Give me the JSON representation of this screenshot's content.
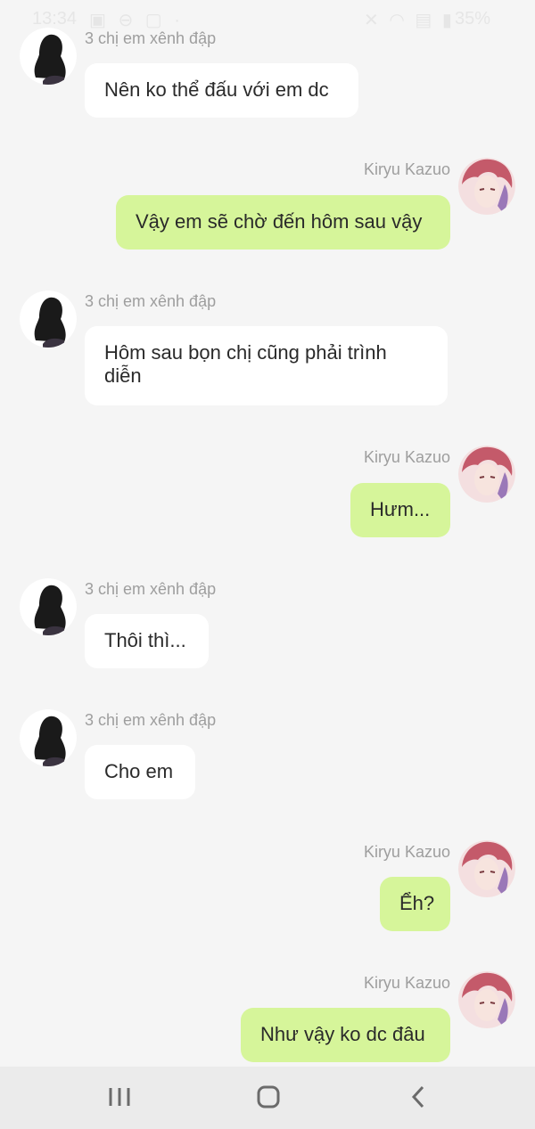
{
  "status": {
    "time": "13:34",
    "battery": "35%"
  },
  "messages": [
    {
      "side": "in",
      "sender": "3 chị em xênh đập",
      "text": "Nên ko thể đấu với em dc"
    },
    {
      "side": "out",
      "sender": "Kiryu Kazuo",
      "text": "Vậy em sẽ chờ đến hôm sau vậy"
    },
    {
      "side": "in",
      "sender": "3 chị em xênh đập",
      "text": "Hôm sau bọn chị cũng phải trình diễn"
    },
    {
      "side": "out",
      "sender": "Kiryu Kazuo",
      "text": "Hưm..."
    },
    {
      "side": "in",
      "sender": "3 chị em xênh đập",
      "text": "Thôi thì..."
    },
    {
      "side": "in",
      "sender": "3 chị em xênh đập",
      "text": "Cho em"
    },
    {
      "side": "out",
      "sender": "Kiryu Kazuo",
      "text": "Ểh?"
    },
    {
      "side": "out",
      "sender": "Kiryu Kazuo",
      "text": "Như vậy ko dc đâu"
    }
  ],
  "nav": {
    "recents": "recents-icon",
    "home": "home-icon",
    "back": "back-icon"
  },
  "colors": {
    "background": "#f5f5f5",
    "incoming_bubble": "#ffffff",
    "outgoing_bubble": "#d6f59a",
    "sender_text": "#9e9e9e"
  }
}
